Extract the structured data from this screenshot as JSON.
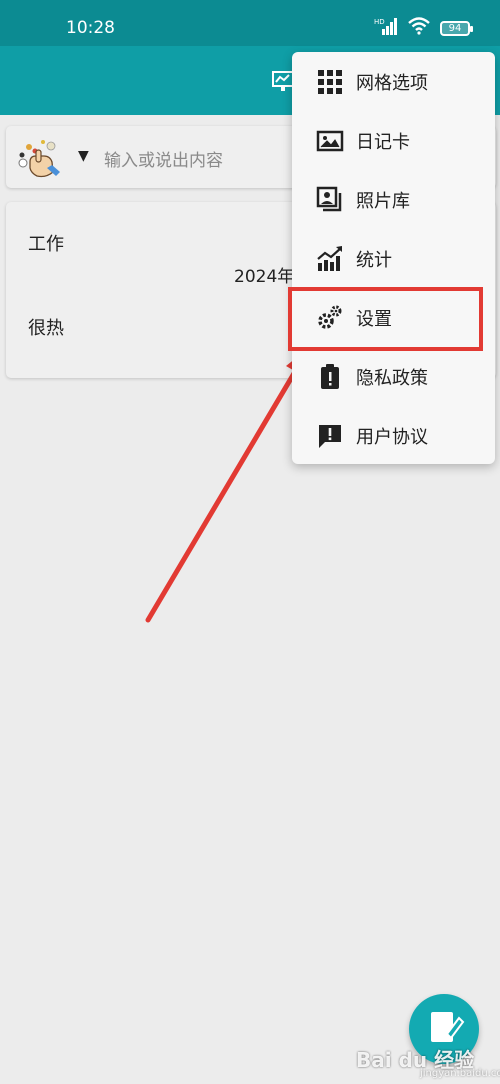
{
  "status_bar": {
    "time": "10:28",
    "battery": "94",
    "network_label": "HD"
  },
  "input": {
    "placeholder": "输入或说出内容",
    "dropdown_arrow": "▼"
  },
  "entry": {
    "title": "工作",
    "date": "2024年",
    "body": "很热"
  },
  "menu": {
    "items": [
      {
        "label": "网格选项",
        "icon": "grid-icon"
      },
      {
        "label": "日记卡",
        "icon": "image-card-icon"
      },
      {
        "label": "照片库",
        "icon": "photo-library-icon"
      },
      {
        "label": "统计",
        "icon": "chart-icon"
      },
      {
        "label": "设置",
        "icon": "gear-icon"
      },
      {
        "label": "隐私政策",
        "icon": "privacy-icon"
      },
      {
        "label": "用户协议",
        "icon": "feedback-icon"
      }
    ]
  },
  "watermark": {
    "text": "Bai du 经验",
    "sub": "jingyan.baidu.com"
  },
  "colors": {
    "appbar": "#0f9ea6",
    "statusbar": "#0c8b92",
    "highlight": "#e23a33",
    "fab": "#13aab2"
  }
}
